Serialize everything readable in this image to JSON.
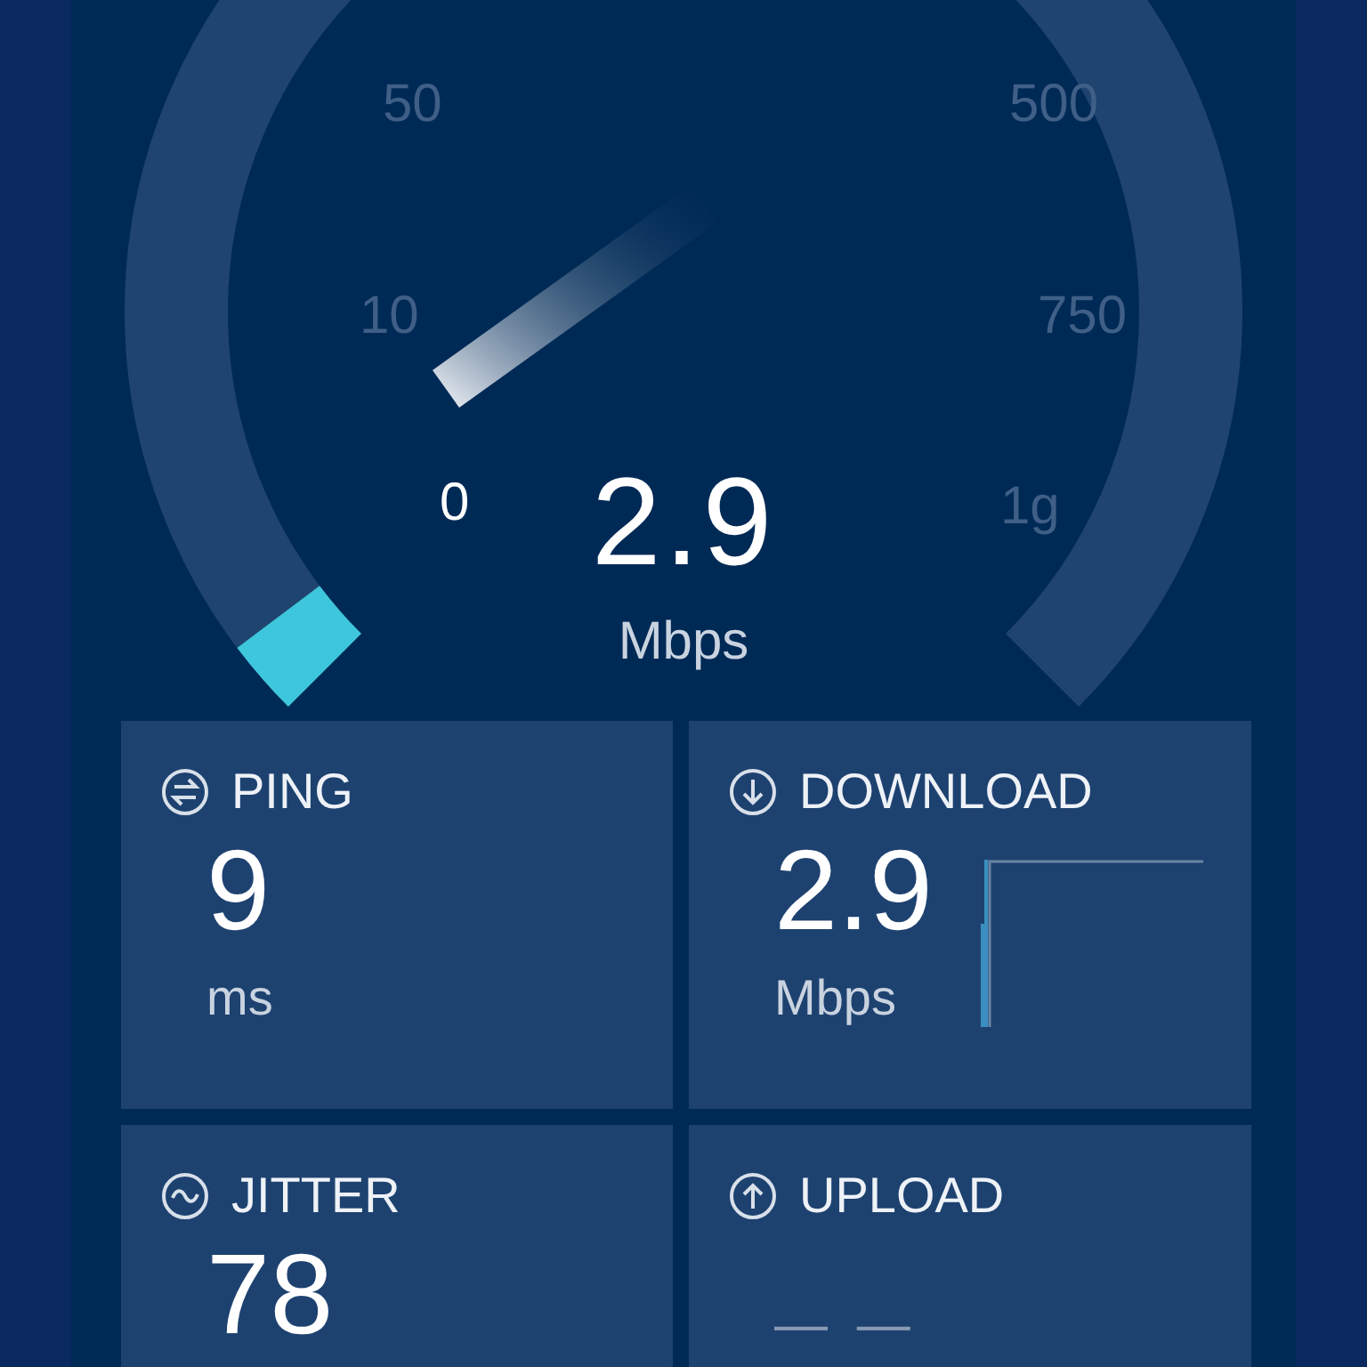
{
  "gauge": {
    "value": "2.9",
    "unit": "Mbps",
    "ticks": [
      "50",
      "10",
      "0",
      "500",
      "750",
      "1g"
    ]
  },
  "cards": [
    {
      "kind": "ping",
      "label": "PING",
      "value": "9",
      "unit": "ms"
    },
    {
      "kind": "download",
      "label": "DOWNLOAD",
      "value": "2.9",
      "unit": "Mbps"
    },
    {
      "kind": "jitter",
      "label": "JITTER",
      "value": "78"
    },
    {
      "kind": "upload",
      "label": "UPLOAD",
      "value": "— —"
    }
  ]
}
